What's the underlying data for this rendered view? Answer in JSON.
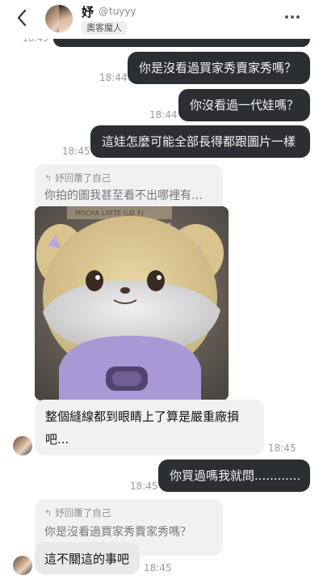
{
  "header": {
    "name": "妤",
    "handle": "tuyyy",
    "tag": "奧客魔人"
  },
  "messages": {
    "cut_time": "18:43",
    "m1": {
      "text": "你是沒看過買家秀賣家秀嗎？",
      "time": "18:44"
    },
    "m2": {
      "text": "你沒看過一代娃嗎？",
      "time": "18:44"
    },
    "m3": {
      "text": "這娃怎麼可能全部長得都跟圖片一樣",
      "time": "18:45"
    },
    "reply1": {
      "quote_header": "妤回覆了自己",
      "quote_text": "你拍的圖我甚至看不出哪裡有…",
      "photo_label": "MOCHA LATTE (LD_F)",
      "text_line1": "整個縫線都到眼睛上了算是嚴重廠損",
      "text_line2": "吧...",
      "time": "18:45"
    },
    "m4": {
      "text": "你買過嗎我就問............",
      "time": "18:45"
    },
    "reply2": {
      "quote_header": "妤回覆了自己",
      "quote_text": "你是沒看過買家秀賣家秀嗎？",
      "text": "這不關這的事吧",
      "time": "18:45"
    }
  }
}
